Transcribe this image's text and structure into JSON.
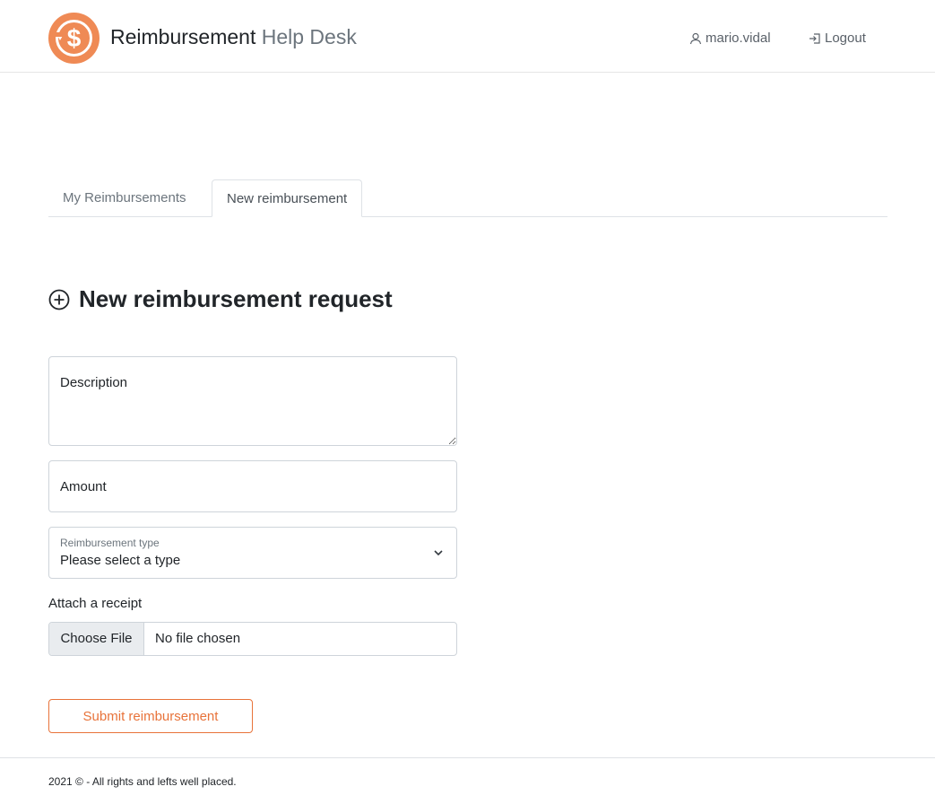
{
  "header": {
    "brand_strong": "Reimbursement",
    "brand_light": "Help Desk",
    "username": "mario.vidal",
    "logout_label": "Logout",
    "accent_color": "#ef8a55"
  },
  "tabs": [
    {
      "label": "My Reimbursements",
      "active": false
    },
    {
      "label": "New reimbursement",
      "active": true
    }
  ],
  "form": {
    "title": "New reimbursement request",
    "title_icon": "plus-circle-icon",
    "description_placeholder": "Description",
    "amount_placeholder": "Amount",
    "type_label": "Reimbursement type",
    "type_value": "Please select a type",
    "attach_label": "Attach a receipt",
    "file_button": "Choose File",
    "file_status": "No file chosen",
    "submit_label": "Submit reimbursement"
  },
  "footer": {
    "text": "2021 © - All rights and lefts well placed."
  }
}
